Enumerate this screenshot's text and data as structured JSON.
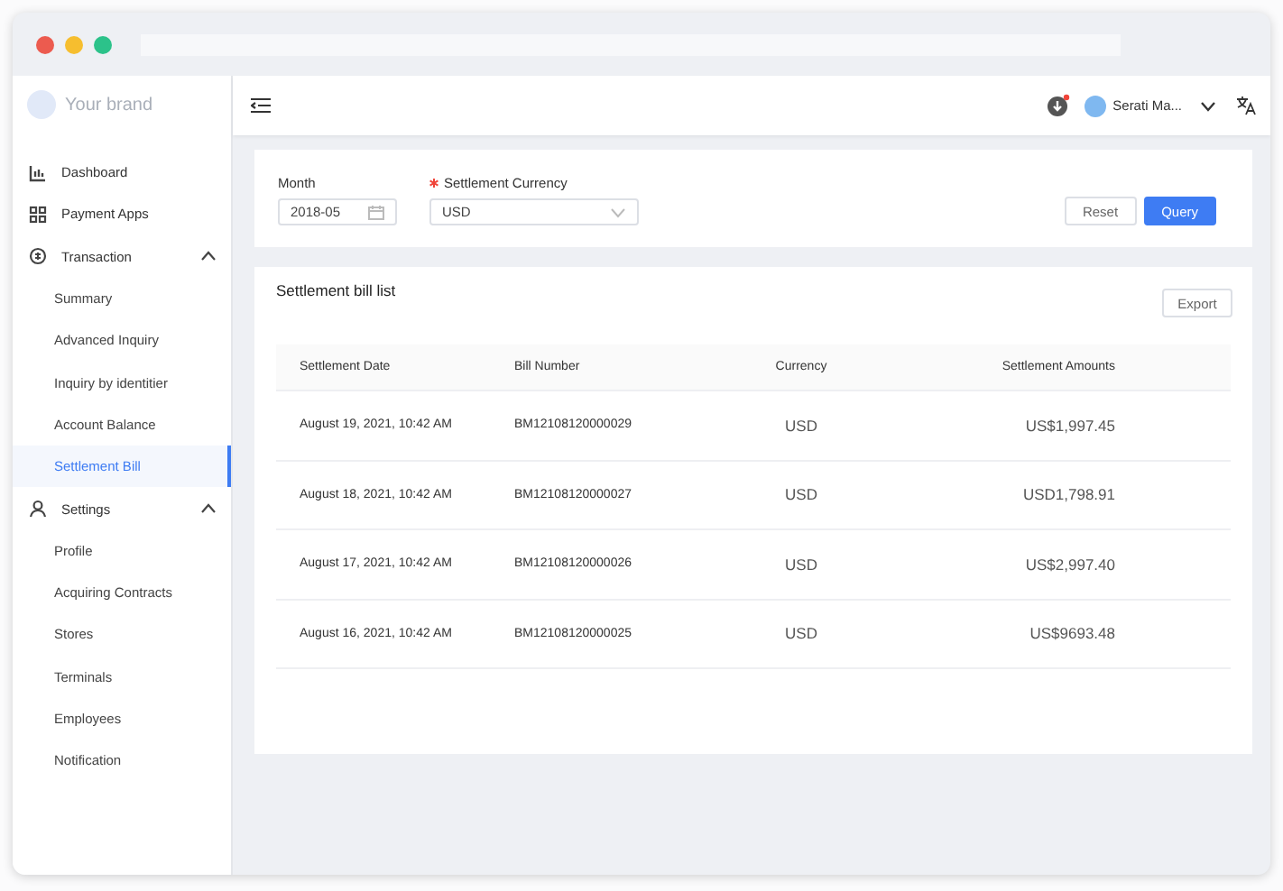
{
  "window": {
    "controls": [
      {
        "color": "#ec5b4f"
      },
      {
        "color": "#f6be2f"
      },
      {
        "color": "#2cc28a"
      }
    ]
  },
  "brand": {
    "name": "Your brand"
  },
  "sidebar": {
    "items": [
      {
        "kind": "item",
        "label": "Dashboard",
        "selected": false
      },
      {
        "kind": "item",
        "label": "Payment Apps",
        "selected": false
      },
      {
        "kind": "group",
        "label": "Transaction",
        "expanded": true,
        "children": [
          {
            "label": "Summary",
            "selected": false
          },
          {
            "label": "Advanced Inquiry",
            "selected": false
          },
          {
            "label": "Inquiry by identitier",
            "selected": false
          },
          {
            "label": "Account Balance",
            "selected": false
          },
          {
            "label": "Settlement Bill",
            "selected": true
          }
        ]
      },
      {
        "kind": "group",
        "label": "Settings",
        "expanded": true,
        "children": [
          {
            "label": "Profile",
            "selected": false
          },
          {
            "label": "Acquiring Contracts",
            "selected": false
          },
          {
            "label": "Stores",
            "selected": false
          },
          {
            "label": "Terminals",
            "selected": false
          },
          {
            "label": "Employees",
            "selected": false
          },
          {
            "label": "Notification",
            "selected": false
          }
        ]
      }
    ]
  },
  "header": {
    "download_badge": true,
    "user": "Serati Ma..."
  },
  "filters": {
    "month": {
      "label": "Month",
      "value": "2018-05"
    },
    "currency": {
      "label": "Settlement Currency",
      "required": true,
      "value": "USD"
    },
    "buttons": [
      {
        "kind": "default",
        "label": "Reset"
      },
      {
        "kind": "primary",
        "label": "Query"
      }
    ]
  },
  "list": {
    "title": "Settlement bill list",
    "export": "Export",
    "columns": [
      "Settlement Date",
      "Bill Number",
      "Currency",
      "Settlement Amounts"
    ],
    "rows": [
      [
        "August 19, 2021, 10:42 AM",
        "BM12108120000029",
        "USD",
        "US$1,997.45"
      ],
      [
        "August 18, 2021, 10:42 AM",
        "BM12108120000027",
        "USD",
        "USD1,798.91"
      ],
      [
        "August 17, 2021, 10:42 AM",
        "BM12108120000026",
        "USD",
        "US$2,997.40"
      ],
      [
        "August 16, 2021, 10:42 AM",
        "BM12108120000025",
        "USD",
        "US$9693.48"
      ]
    ]
  }
}
